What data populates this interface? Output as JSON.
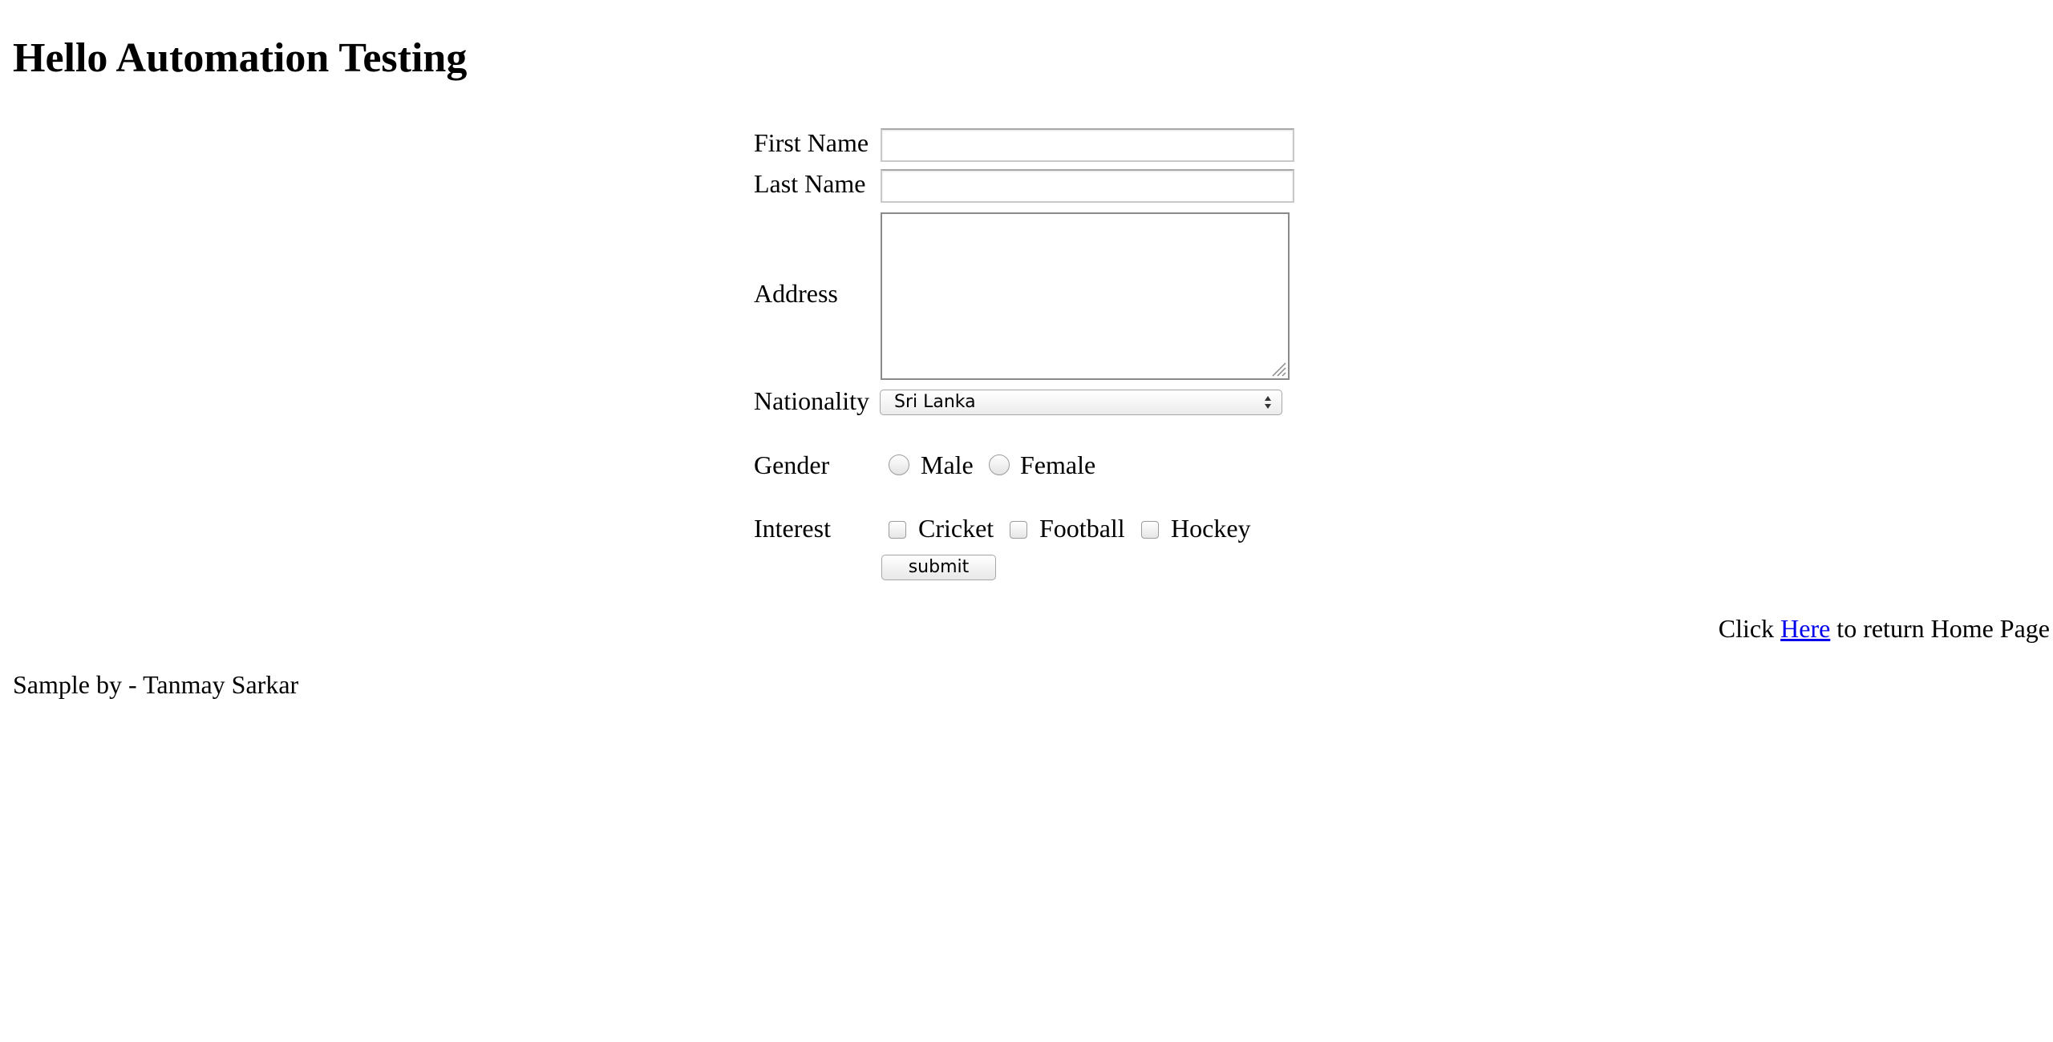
{
  "page": {
    "title": "Hello Automation Testing"
  },
  "form": {
    "first_name": {
      "label": "First Name",
      "value": ""
    },
    "last_name": {
      "label": "Last Name",
      "value": ""
    },
    "address": {
      "label": "Address",
      "value": ""
    },
    "nationality": {
      "label": "Nationality",
      "selected": "Sri Lanka"
    },
    "gender": {
      "label": "Gender",
      "options": [
        {
          "label": "Male",
          "checked": false
        },
        {
          "label": "Female",
          "checked": false
        }
      ]
    },
    "interest": {
      "label": "Interest",
      "options": [
        {
          "label": "Cricket",
          "checked": false
        },
        {
          "label": "Football",
          "checked": false
        },
        {
          "label": "Hockey",
          "checked": false
        }
      ]
    },
    "submit_label": "submit"
  },
  "return_link": {
    "prefix": "Click",
    "link_text": "Here",
    "suffix": "to return Home Page"
  },
  "footer": {
    "text": "Sample by - Tanmay Sarkar"
  },
  "colors": {
    "link": "#0000ee",
    "text": "#000000",
    "background": "#ffffff"
  }
}
